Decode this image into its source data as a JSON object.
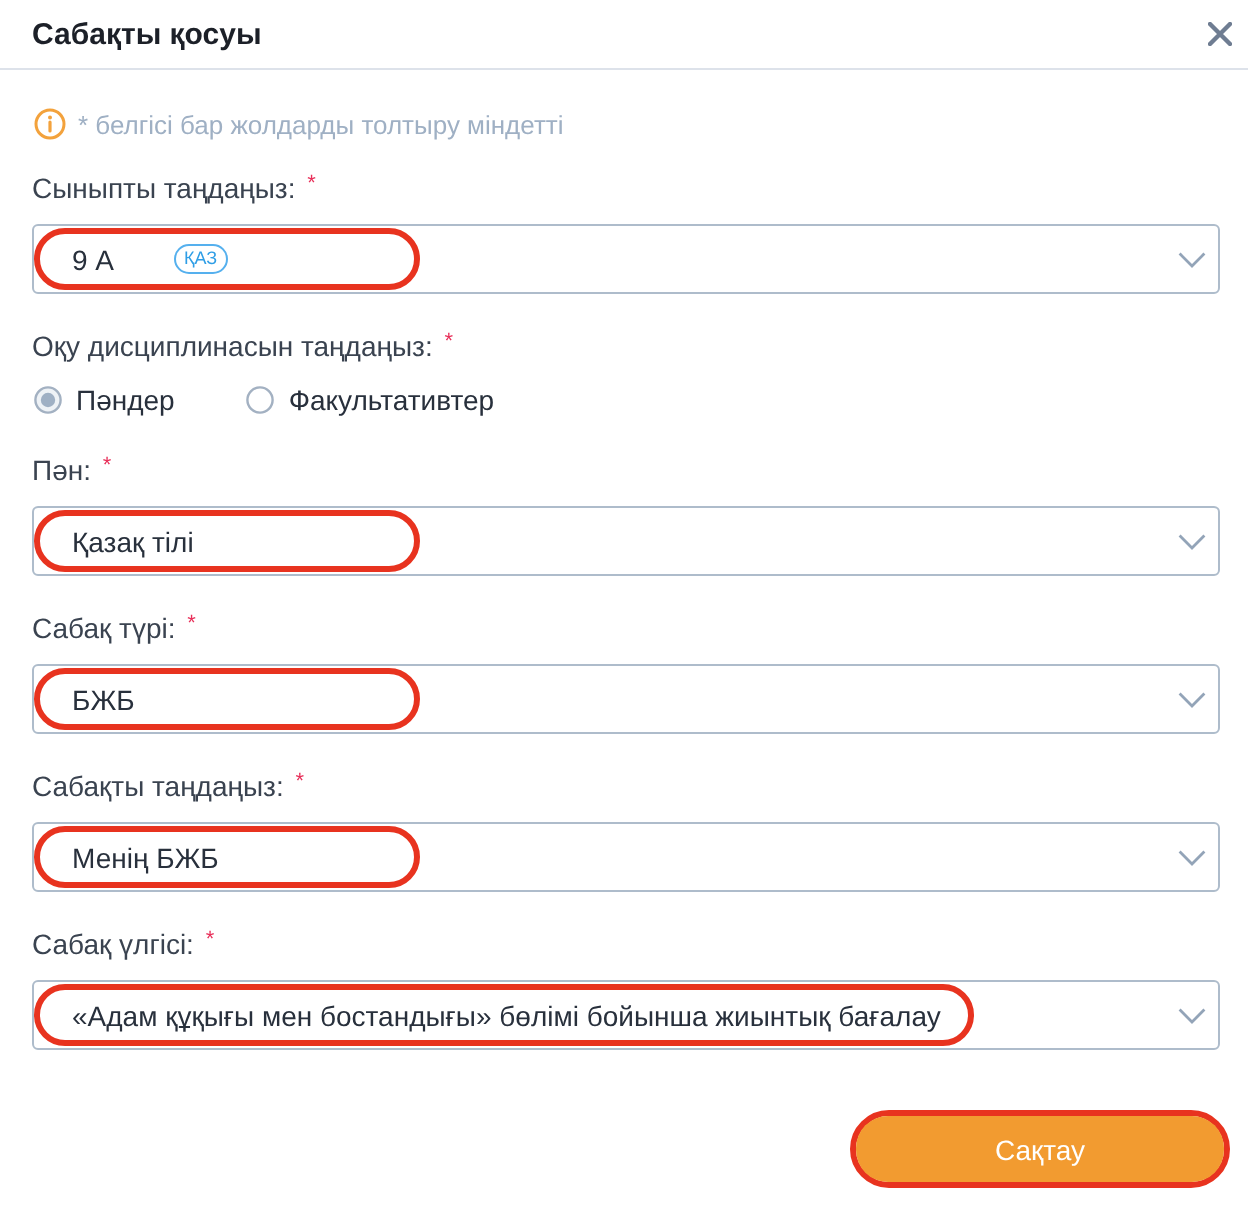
{
  "dialog": {
    "title": "Сабақты қосуы"
  },
  "notice": {
    "text": "* белгісі бар жолдарды толтыру міндетті"
  },
  "fields": [
    {
      "kind": "select",
      "label": "Сыныпты таңдаңыз: $^{*}$",
      "value": "9 А",
      "badge": "ҚАЗ",
      "highlighted": true
    },
    {
      "kind": "radio",
      "label": "Оқу дисциплинасын таңдаңыз: $^{*}$",
      "options": [
        {
          "label": "Пәндер",
          "selected": true
        },
        {
          "label": "Факультативтер",
          "selected": false
        }
      ]
    },
    {
      "kind": "select",
      "label": "Пән: $^{*}$",
      "value": "Қазақ тілі",
      "highlighted": true
    },
    {
      "kind": "select",
      "label": "Сабақ түрі: $^{*}$",
      "value": "БЖБ",
      "highlighted": true
    },
    {
      "kind": "select",
      "label": "Сабақты таңдаңыз: $^{*}$",
      "value": "Менің БЖБ",
      "highlighted": true
    },
    {
      "kind": "select",
      "label": "Сабақ үлгісі: $^{*}$",
      "value": "«Адам құқығы мен бостандығы» бөлімі бойынша жиынтық бағалау",
      "highlighted": true
    }
  ],
  "save_button": {
    "label": "Сақтау",
    "highlighted": true
  }
}
